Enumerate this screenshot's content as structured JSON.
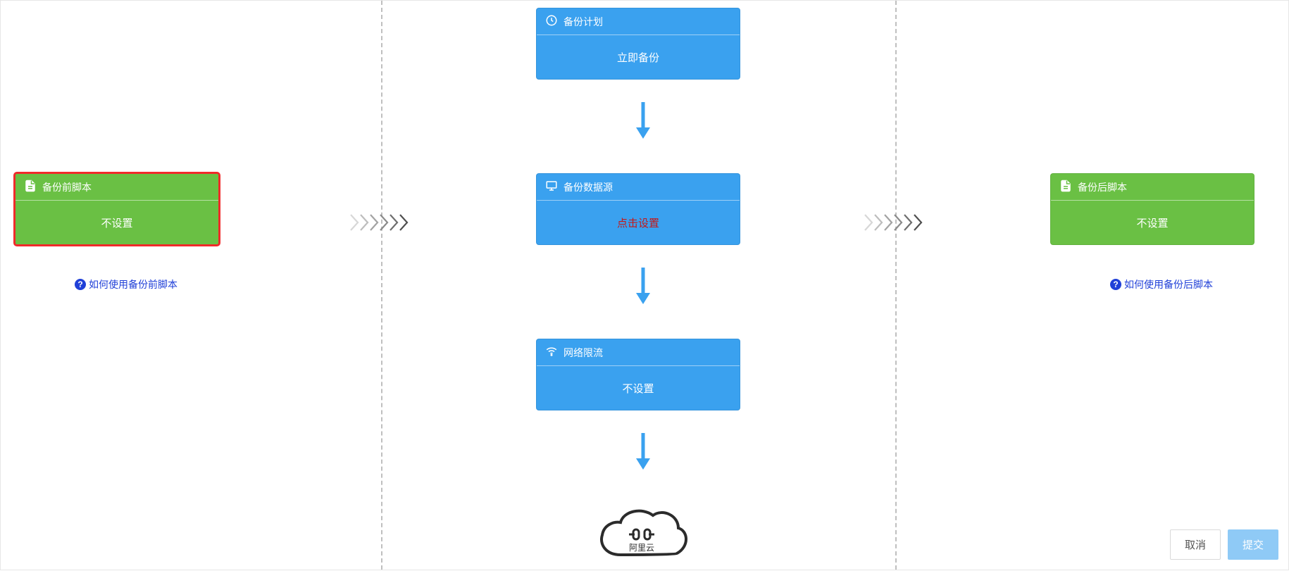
{
  "cards": {
    "pre_script": {
      "title": "备份前脚本",
      "value": "不设置"
    },
    "post_script": {
      "title": "备份后脚本",
      "value": "不设置"
    },
    "backup_plan": {
      "title": "备份计划",
      "value": "立即备份"
    },
    "data_source": {
      "title": "备份数据源",
      "value": "点击设置"
    },
    "throttle": {
      "title": "网络限流",
      "value": "不设置"
    }
  },
  "links": {
    "pre_help": "如何使用备份前脚本",
    "post_help": "如何使用备份后脚本"
  },
  "cloud_label": "阿里云",
  "buttons": {
    "cancel": "取消",
    "submit": "提交"
  }
}
